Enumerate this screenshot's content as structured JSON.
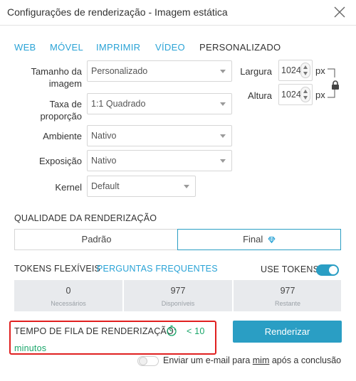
{
  "window": {
    "title": "Configurações de renderização - Imagem estática"
  },
  "tabs": [
    {
      "label": "WEB"
    },
    {
      "label": "MÓVEL"
    },
    {
      "label": "IMPRIMIR"
    },
    {
      "label": "VÍDEO"
    },
    {
      "label": "PERSONALIZADO"
    }
  ],
  "settings": {
    "image_size": {
      "label_line1": "Tamanho da",
      "label_line2": "imagem",
      "value": "Personalizado"
    },
    "aspect_ratio": {
      "label_line1": "Taxa de",
      "label_line2": "proporção",
      "value": "1:1 Quadrado"
    },
    "environment": {
      "label": "Ambiente",
      "value": "Nativo"
    },
    "exposure": {
      "label": "Exposição",
      "value": "Nativo"
    },
    "kernel": {
      "label": "Kernel",
      "value": "Default"
    }
  },
  "dimensions": {
    "width": {
      "label": "Largura",
      "value": "1024",
      "unit": "px"
    },
    "height": {
      "label": "Altura",
      "value": "1024",
      "unit": "px"
    },
    "lock_icon": "padlock-icon"
  },
  "quality": {
    "title": "QUALIDADE DA RENDERIZAÇÃO",
    "options": [
      {
        "label": "Padrão",
        "selected": false
      },
      {
        "label": "Final",
        "selected": true
      }
    ]
  },
  "tokens": {
    "title": "TOKENS FLEXÍVEIS",
    "faq_link": "PERGUNTAS FREQUENTES",
    "use_tokens_label": "USE TOKENS",
    "use_tokens_on": true,
    "stats": [
      {
        "value": "0",
        "caption": "Necessários"
      },
      {
        "value": "977",
        "caption": "Disponíveis"
      },
      {
        "value": "977",
        "caption": "Restante"
      }
    ]
  },
  "queue": {
    "label": "TEMPO DE FILA DE RENDERIZAÇÃO:",
    "value_part1": "< 10",
    "value_part2": "minutos",
    "icon": "timer-icon"
  },
  "render_button": {
    "label": "Renderizar"
  },
  "email": {
    "prefix": "Enviar um e-mail para ",
    "me": "mim",
    "suffix": " após a conclusão",
    "enabled": false
  },
  "colors": {
    "accent": "#2aa3d6",
    "primary_button": "#2a9ec4",
    "queue_value": "#1aa66a",
    "highlight_border": "#e02020",
    "stats_bg": "#e8eaed"
  }
}
